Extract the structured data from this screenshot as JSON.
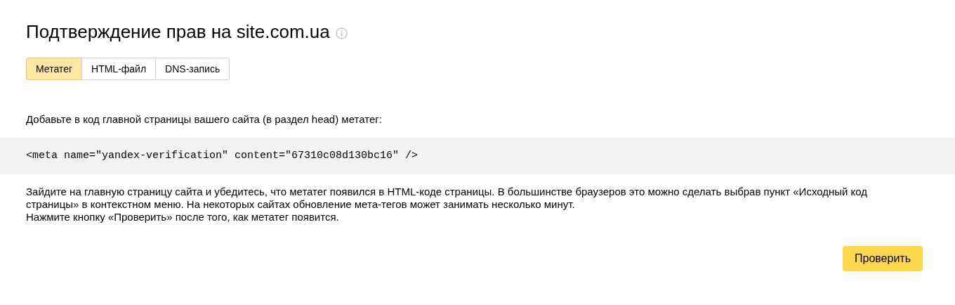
{
  "title": "Подтверждение прав на site.com.ua",
  "tabs": [
    {
      "label": "Метатег",
      "selected": true
    },
    {
      "label": "HTML-файл",
      "selected": false
    },
    {
      "label": "DNS-запись",
      "selected": false
    }
  ],
  "intro": "Добавьте в код главной страницы вашего сайта (в раздел head) метатег:",
  "code": "<meta name=\"yandex-verification\" content=\"67310c08d130bc16\" />",
  "instructions": "Зайдите на главную страницу сайта и убедитесь, что метатег появился в HTML-коде страницы. В большинстве браузеров это можно сделать выбрав пункт «Исходный код страницы» в контекстном меню. На некоторых сайтах обновление мета-тегов может занимать несколько минут.",
  "note": "Нажмите кнопку «Проверить» после того, как метатег появится.",
  "button": "Проверить"
}
